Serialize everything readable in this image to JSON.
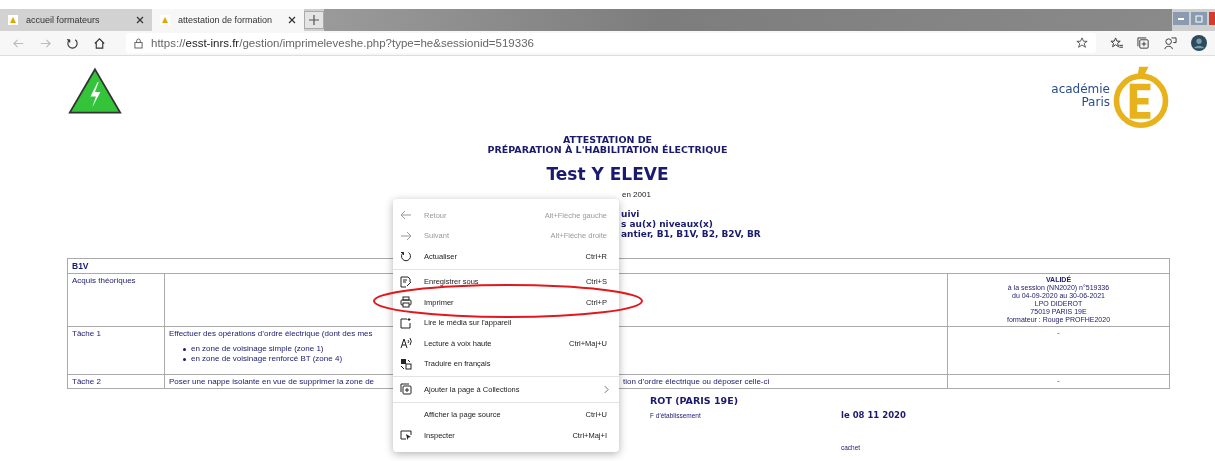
{
  "browser": {
    "tabs": [
      {
        "label": "accueil formateurs",
        "selected": false
      },
      {
        "label": "attestation de formation",
        "selected": true
      }
    ],
    "url": {
      "scheme": "https://",
      "domain": "esst-inrs.fr",
      "path": "/gestion/imprimeleveshe.php?type=he&sessionid=519336"
    }
  },
  "page": {
    "logo_text": [
      "académie",
      "Paris"
    ],
    "heading_lines": [
      "ATTESTATION DE",
      "PRÉPARATION À L'HABILITATION ÉLECTRIQUE"
    ],
    "student_name": "Test Y ELEVE",
    "birth": "en 2001",
    "info_lines": [
      "uivi",
      "s au(x) niveaux(x)",
      "antier, B1, B1V, B2, B2V, BR"
    ],
    "table": {
      "level": "B1V",
      "rows": [
        {
          "label": "Acquis théoriques",
          "parts": [],
          "bullets": [],
          "status": {
            "kind": "validated",
            "lines": [
              "VALIDÉ",
              "à la session (NN2020) n°519336",
              "du 04-09-2020 au 30-06-2021",
              "LPO DIDEROT",
              "75019 PARIS 19E",
              "formateur : Rouge PROFHE2020"
            ]
          }
        },
        {
          "label": "Tâche 1",
          "parts": [
            "Effectuer des opérations d’ordre électrique (dont des mes"
          ],
          "bullets": [
            "en zone de voisinage simple (zone 1)",
            "en zone de voisinage renforcé BT (zone 4)"
          ],
          "status": {
            "kind": "pending",
            "lines": [
              "-"
            ]
          }
        },
        {
          "label": "Tâche 2",
          "parts": [
            "Poser une nappe isolante en vue de supprimer la zone de",
            "tion d’ordre électrique ou déposer celle-ci"
          ],
          "bullets": [],
          "status": {
            "kind": "pending",
            "lines": [
              "-"
            ]
          }
        }
      ]
    },
    "school": "ROT (PARIS 19E)",
    "signature_label": "F d'établissement",
    "date": "le 08 11 2020",
    "stamp": "cachet"
  },
  "context_menu": {
    "groups": [
      [
        {
          "label": "Retour",
          "shortcut": "Alt+Flèche gauche",
          "disabled": true,
          "submenu": false
        },
        {
          "label": "Suivant",
          "shortcut": "Alt+Flèche droite",
          "disabled": true,
          "submenu": false
        },
        {
          "label": "Actualiser",
          "shortcut": "Ctrl+R",
          "disabled": false,
          "submenu": false
        }
      ],
      [
        {
          "label": "Enregistrer sous",
          "shortcut": "Ctrl+S",
          "disabled": false,
          "submenu": false
        },
        {
          "label": "Imprimer",
          "shortcut": "Ctrl+P",
          "disabled": false,
          "submenu": false
        },
        {
          "label": "Lire le média sur l'appareil",
          "disabled": false,
          "submenu": false
        },
        {
          "label": "Lecture à voix haute",
          "shortcut": "Ctrl+Maj+U",
          "disabled": false,
          "submenu": false
        },
        {
          "label": "Traduire en français",
          "disabled": false,
          "submenu": false
        }
      ],
      [
        {
          "label": "Ajouter la page à Collections",
          "disabled": false,
          "submenu": true
        }
      ],
      [
        {
          "label": "Afficher la page source",
          "shortcut": "Ctrl+U",
          "disabled": false,
          "submenu": false
        },
        {
          "label": "Inspecter",
          "shortcut": "Ctrl+Maj+I",
          "disabled": false,
          "submenu": false
        }
      ]
    ]
  }
}
